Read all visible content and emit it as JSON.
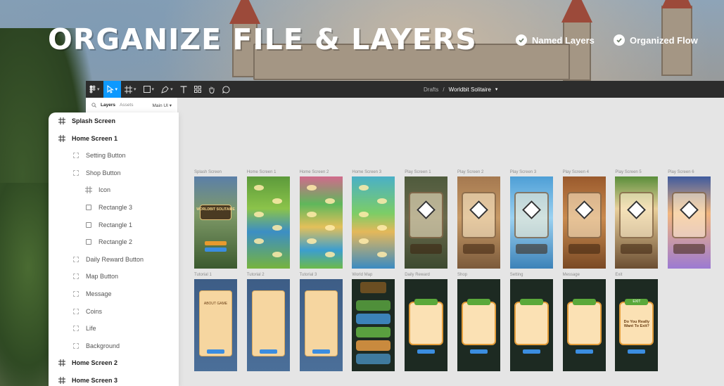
{
  "headline": "ORGANIZE FILE & LAYERS",
  "badges": [
    {
      "label": "Named Layers",
      "icon": "check-icon"
    },
    {
      "label": "Organized Flow",
      "icon": "check-icon"
    }
  ],
  "figma": {
    "breadcrumb": {
      "parent": "Drafts",
      "separator": "/",
      "file": "Worldbit Solitaire"
    },
    "panel": {
      "tab_layers": "Layers",
      "tab_assets": "Assets",
      "page": "Main UI"
    },
    "accent": "#0d99ff"
  },
  "layers": [
    {
      "label": "Splash Screen",
      "type": "frame",
      "indent": 0
    },
    {
      "label": "Home Screen 1",
      "type": "frame",
      "indent": 0
    },
    {
      "label": "Setting Button",
      "type": "group",
      "indent": 1
    },
    {
      "label": "Shop Button",
      "type": "group",
      "indent": 1
    },
    {
      "label": "Icon",
      "type": "frame",
      "indent": 2
    },
    {
      "label": "Rectangle 3",
      "type": "rect",
      "indent": 2
    },
    {
      "label": "Rectangle 1",
      "type": "rect",
      "indent": 2
    },
    {
      "label": "Rectangle 2",
      "type": "rect",
      "indent": 2
    },
    {
      "label": "Daily Reward Button",
      "type": "group",
      "indent": 1
    },
    {
      "label": "Map Button",
      "type": "group",
      "indent": 1
    },
    {
      "label": "Message",
      "type": "group",
      "indent": 1
    },
    {
      "label": "Coins",
      "type": "group",
      "indent": 1
    },
    {
      "label": "Life",
      "type": "group",
      "indent": 1
    },
    {
      "label": "Background",
      "type": "group",
      "indent": 1
    },
    {
      "label": "Home Screen 2",
      "type": "frame",
      "indent": 0
    },
    {
      "label": "Home Screen 3",
      "type": "frame",
      "indent": 0
    }
  ],
  "frames_row1": [
    {
      "label": "Splash Screen",
      "style": "f-splash",
      "kind": "splash"
    },
    {
      "label": "Home Screen 1",
      "style": "f-green",
      "kind": "map"
    },
    {
      "label": "Home Screen 2",
      "style": "f-colorful",
      "kind": "map"
    },
    {
      "label": "Home Screen 3",
      "style": "f-teal",
      "kind": "map"
    },
    {
      "label": "Play Screen 1",
      "style": "f-play-dark",
      "kind": "play"
    },
    {
      "label": "Play Screen 2",
      "style": "f-play-brown",
      "kind": "play"
    },
    {
      "label": "Play Screen 3",
      "style": "f-play-blue",
      "kind": "play"
    },
    {
      "label": "Play Screen 4",
      "style": "f-play-orange",
      "kind": "play"
    },
    {
      "label": "Play Screen 5",
      "style": "f-play-cream",
      "kind": "play"
    },
    {
      "label": "Play Screen 6",
      "style": "f-play-purple",
      "kind": "play"
    }
  ],
  "frames_row2": [
    {
      "label": "Tutorial 1",
      "style": "f-tut",
      "kind": "tutorial"
    },
    {
      "label": "Tutorial 2",
      "style": "f-tut",
      "kind": "tutorial"
    },
    {
      "label": "Tutorial 3",
      "style": "f-tut",
      "kind": "tutorial"
    },
    {
      "label": "World Map",
      "style": "f-dark",
      "kind": "worldmap"
    },
    {
      "label": "Daily Reward",
      "style": "f-dark",
      "kind": "popup"
    },
    {
      "label": "Shop",
      "style": "f-dark",
      "kind": "popup"
    },
    {
      "label": "Setting",
      "style": "f-dark",
      "kind": "popup"
    },
    {
      "label": "Message",
      "style": "f-dark",
      "kind": "popup"
    },
    {
      "label": "Exit",
      "style": "f-dark",
      "kind": "popup"
    }
  ],
  "frame_texts": {
    "splash_logo": "WORLDBIT SOLITAIRE",
    "tutorial_heading": "ABOUT GAME",
    "exit_heading": "EXIT",
    "exit_question": "Do You Really Want To Exit?"
  }
}
